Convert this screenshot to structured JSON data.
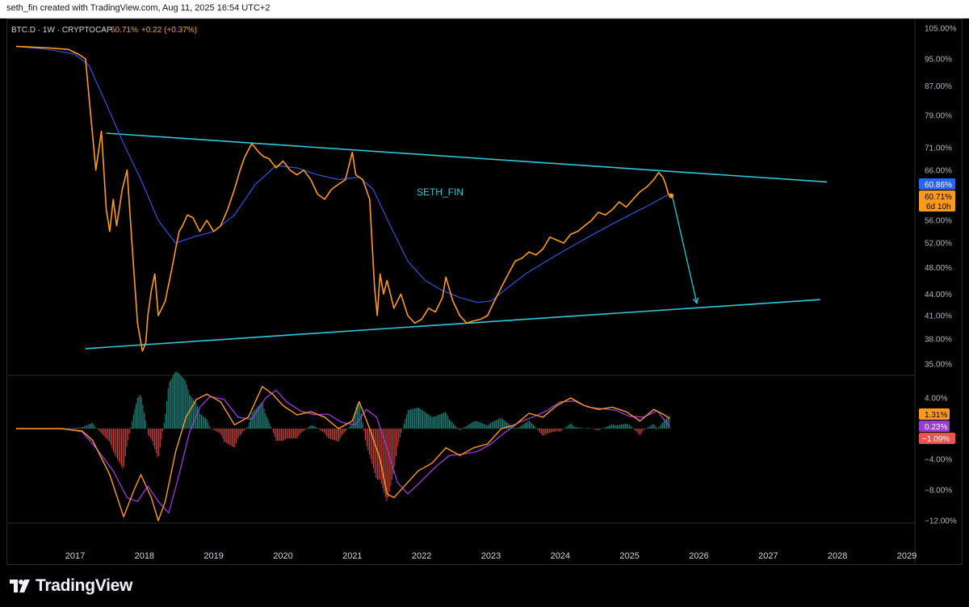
{
  "header": {
    "attribution": "seth_fin created with TradingView.com, Aug 11, 2025 16:54 UTC+2"
  },
  "legend": {
    "symbol": "BTC.D · 1W · CRYPTOCAP",
    "last_value": "60.71%",
    "change": "+0.22 (+0.37%)"
  },
  "annotation": "SETH_FIN",
  "colors": {
    "price": "#ff9a1f",
    "ma": "#3552d8",
    "trendline": "#2ec9db",
    "macd": "#ff9a1f",
    "signal": "#9b3bd6",
    "hist_pos": "#26a69a",
    "hist_neg": "#ef5350"
  },
  "badges": {
    "ma_value": "60.86%",
    "price_value": "60.71%",
    "countdown": "6d 10h",
    "macd_value": "1.31%",
    "signal_value": "0.23%",
    "hist_value": "−1.09%"
  },
  "chart_data": {
    "type": "line",
    "title": "BTC.D · 1W · CRYPTOCAP",
    "x_ticks": [
      "2017",
      "2018",
      "2019",
      "2020",
      "2021",
      "2022",
      "2023",
      "2024",
      "2025",
      "2026",
      "2027",
      "2028",
      "2029"
    ],
    "y_ticks": [
      "105.00%",
      "95.00%",
      "87.00%",
      "79.00%",
      "71.00%",
      "66.00%",
      "56.00%",
      "52.00%",
      "48.00%",
      "44.00%",
      "41.00%",
      "38.00%",
      "35.00%"
    ],
    "y_scale": "log",
    "series": [
      {
        "name": "BTC.D",
        "x": [
          2016.15,
          2016.6,
          2016.9,
          2017.05,
          2017.15,
          2017.22,
          2017.3,
          2017.38,
          2017.45,
          2017.5,
          2017.55,
          2017.6,
          2017.68,
          2017.75,
          2017.82,
          2017.9,
          2017.97,
          2018.02,
          2018.05,
          2018.1,
          2018.15,
          2018.2,
          2018.3,
          2018.4,
          2018.45,
          2018.5,
          2018.55,
          2018.62,
          2018.7,
          2018.8,
          2018.9,
          2019.0,
          2019.1,
          2019.2,
          2019.3,
          2019.38,
          2019.45,
          2019.55,
          2019.65,
          2019.72,
          2019.8,
          2019.9,
          2020.0,
          2020.1,
          2020.2,
          2020.3,
          2020.4,
          2020.5,
          2020.6,
          2020.7,
          2020.8,
          2020.9,
          2021.0,
          2021.05,
          2021.15,
          2021.25,
          2021.32,
          2021.36,
          2021.4,
          2021.45,
          2021.5,
          2021.6,
          2021.7,
          2021.8,
          2021.9,
          2022.0,
          2022.1,
          2022.2,
          2022.3,
          2022.35,
          2022.45,
          2022.55,
          2022.65,
          2022.75,
          2022.85,
          2022.95,
          2023.05,
          2023.15,
          2023.25,
          2023.35,
          2023.45,
          2023.55,
          2023.65,
          2023.75,
          2023.85,
          2023.95,
          2024.05,
          2024.15,
          2024.25,
          2024.35,
          2024.45,
          2024.55,
          2024.65,
          2024.75,
          2024.85,
          2024.95,
          2025.05,
          2025.15,
          2025.25,
          2025.35,
          2025.42,
          2025.48,
          2025.52,
          2025.56,
          2025.6
        ],
        "y": [
          99.0,
          98.5,
          98.0,
          96.5,
          95.0,
          80.0,
          66.0,
          75.0,
          58.0,
          54.0,
          60.0,
          55.0,
          62.0,
          66.0,
          52.0,
          40.0,
          36.5,
          37.5,
          41.0,
          44.5,
          47.0,
          41.0,
          43.0,
          48.0,
          51.0,
          54.0,
          55.0,
          57.0,
          56.5,
          54.0,
          56.0,
          54.0,
          55.0,
          58.0,
          62.0,
          66.0,
          69.0,
          72.0,
          70.0,
          69.0,
          68.5,
          66.5,
          68.0,
          66.0,
          65.0,
          66.0,
          64.0,
          61.0,
          60.0,
          62.0,
          63.0,
          64.0,
          70.0,
          65.0,
          64.0,
          60.0,
          45.0,
          41.0,
          47.0,
          44.0,
          46.0,
          42.0,
          44.0,
          41.0,
          40.0,
          40.5,
          42.0,
          41.5,
          43.5,
          46.5,
          43.0,
          41.0,
          40.0,
          40.3,
          40.5,
          41.0,
          43.0,
          45.0,
          47.0,
          49.0,
          49.5,
          50.5,
          50.0,
          51.0,
          53.0,
          52.5,
          52.0,
          53.5,
          54.0,
          55.0,
          56.0,
          57.5,
          57.0,
          58.0,
          59.5,
          58.5,
          60.0,
          61.5,
          62.5,
          64.0,
          65.5,
          64.5,
          63.0,
          61.0,
          60.7
        ]
      },
      {
        "name": "MA",
        "x": [
          2016.15,
          2016.6,
          2017.0,
          2017.2,
          2017.45,
          2017.7,
          2017.95,
          2018.2,
          2018.45,
          2018.7,
          2019.0,
          2019.3,
          2019.6,
          2019.9,
          2020.2,
          2020.5,
          2020.8,
          2021.1,
          2021.3,
          2021.55,
          2021.8,
          2022.05,
          2022.3,
          2022.55,
          2022.8,
          2023.0,
          2023.25,
          2023.5,
          2023.8,
          2024.1,
          2024.4,
          2024.7,
          2025.0,
          2025.3,
          2025.55
        ],
        "y": [
          99.0,
          98.0,
          96.5,
          93.0,
          82.0,
          72.0,
          64.0,
          56.0,
          52.0,
          53.0,
          54.0,
          57.0,
          63.0,
          67.0,
          66.5,
          65.0,
          64.0,
          64.5,
          62.0,
          55.0,
          49.0,
          46.0,
          44.5,
          43.5,
          42.8,
          43.0,
          45.0,
          47.0,
          49.0,
          51.0,
          53.0,
          55.0,
          57.0,
          59.0,
          60.86
        ]
      }
    ],
    "trendlines": [
      {
        "name": "upper",
        "x": [
          2017.45,
          2027.85
        ],
        "y": [
          74.5,
          63.5
        ]
      },
      {
        "name": "lower",
        "x": [
          2017.15,
          2027.75
        ],
        "y": [
          36.8,
          43.2
        ]
      }
    ],
    "projection": {
      "x": [
        2025.62,
        2025.97
      ],
      "y": [
        60.4,
        42.7
      ]
    }
  },
  "macd_data": {
    "type": "line",
    "y_ticks": [
      "4.00%",
      "−4.00%",
      "−8.00%",
      "−12.00%"
    ],
    "ylim": [
      -12.5,
      6.5
    ],
    "macd": {
      "x": [
        2016.15,
        2016.8,
        2017.1,
        2017.25,
        2017.5,
        2017.7,
        2017.85,
        2017.95,
        2018.0,
        2018.1,
        2018.2,
        2018.3,
        2018.45,
        2018.6,
        2018.75,
        2018.9,
        2019.1,
        2019.3,
        2019.5,
        2019.7,
        2019.85,
        2020.0,
        2020.2,
        2020.4,
        2020.6,
        2020.8,
        2021.0,
        2021.1,
        2021.25,
        2021.4,
        2021.5,
        2021.6,
        2021.75,
        2021.95,
        2022.15,
        2022.35,
        2022.55,
        2022.75,
        2022.95,
        2023.15,
        2023.35,
        2023.55,
        2023.75,
        2023.95,
        2024.15,
        2024.35,
        2024.55,
        2024.75,
        2024.95,
        2025.15,
        2025.35,
        2025.5,
        2025.58
      ],
      "y": [
        0,
        0,
        -0.3,
        -1.5,
        -6,
        -11.5,
        -8,
        -6,
        -7,
        -9,
        -12,
        -9.5,
        -3,
        1.5,
        3.8,
        4.5,
        3.5,
        0.5,
        1.5,
        5.5,
        4.5,
        3.0,
        1.8,
        2.2,
        1.5,
        0.0,
        1.0,
        3.5,
        0.0,
        -4.0,
        -8.5,
        -9.0,
        -7.5,
        -5.5,
        -4.5,
        -2.5,
        -3.5,
        -2.5,
        -2.0,
        0.0,
        0.5,
        2.0,
        1.5,
        3.0,
        4.0,
        3.0,
        2.5,
        2.8,
        2.2,
        1.0,
        2.5,
        1.8,
        1.31
      ]
    },
    "signal": {
      "x": [
        2016.15,
        2016.8,
        2017.1,
        2017.3,
        2017.55,
        2017.75,
        2017.9,
        2018.05,
        2018.2,
        2018.35,
        2018.5,
        2018.65,
        2018.8,
        2018.95,
        2019.15,
        2019.35,
        2019.55,
        2019.75,
        2019.9,
        2020.05,
        2020.25,
        2020.45,
        2020.65,
        2020.85,
        2021.05,
        2021.2,
        2021.35,
        2021.5,
        2021.65,
        2021.8,
        2022.0,
        2022.2,
        2022.4,
        2022.6,
        2022.8,
        2023.0,
        2023.2,
        2023.4,
        2023.6,
        2023.8,
        2024.0,
        2024.2,
        2024.4,
        2024.6,
        2024.8,
        2025.0,
        2025.2,
        2025.4,
        2025.58
      ],
      "y": [
        0,
        0,
        -0.4,
        -2.5,
        -5.5,
        -9.0,
        -9.5,
        -7.5,
        -9.5,
        -11.0,
        -6.0,
        -0.5,
        2.8,
        4.2,
        3.8,
        1.5,
        1.2,
        4.0,
        5.0,
        3.5,
        2.3,
        1.8,
        1.9,
        0.8,
        0.5,
        2.5,
        1.5,
        -2.5,
        -7.0,
        -8.5,
        -6.8,
        -5.0,
        -3.5,
        -3.3,
        -3.0,
        -2.0,
        -0.5,
        0.8,
        1.5,
        2.3,
        3.5,
        3.6,
        2.8,
        2.6,
        2.4,
        1.6,
        1.5,
        2.3,
        0.23
      ]
    }
  }
}
